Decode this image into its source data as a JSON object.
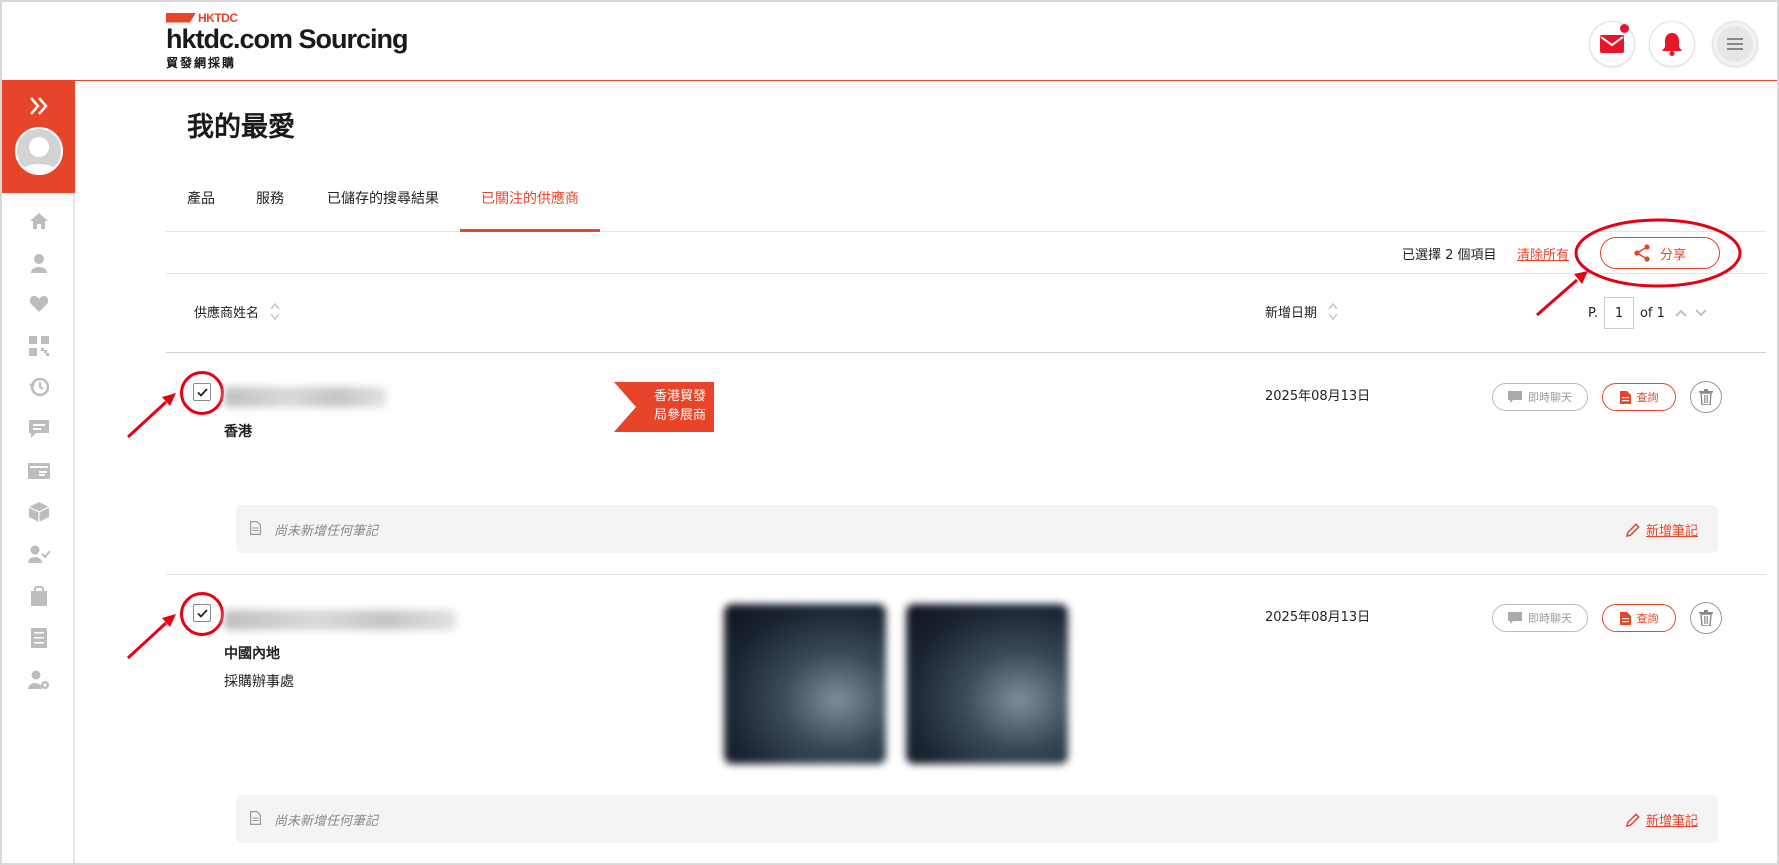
{
  "header": {
    "logo_brand": "HKTDC",
    "logo_title": "hktdc.com Sourcing",
    "logo_subtitle": "貿發網採購",
    "mail_icon": "mail-icon",
    "bell_icon": "bell-icon",
    "menu_icon": "menu-icon",
    "brand_color": "#e8442a"
  },
  "sidebar": {
    "expand_icon": "double-chevron-right-icon",
    "items": [
      "home-icon",
      "user-icon",
      "heart-icon",
      "qr-code-icon",
      "history-icon",
      "chat-icon",
      "id-card-icon",
      "box-icon",
      "user-check-icon",
      "bag-icon",
      "list-icon",
      "user-settings-icon"
    ]
  },
  "page": {
    "title": "我的最愛",
    "tabs": [
      {
        "label": "產品",
        "active": false
      },
      {
        "label": "服務",
        "active": false
      },
      {
        "label": "已儲存的搜尋結果",
        "active": false
      },
      {
        "label": "已關注的供應商",
        "active": true
      }
    ]
  },
  "selection": {
    "count_text": "已選擇 2 個項目",
    "clear_label": "清除所有",
    "share_label": "分享"
  },
  "columns": {
    "supplier_name": "供應商姓名",
    "date_added": "新增日期",
    "page_prefix": "P.",
    "page_value": "1",
    "page_of": "of 1"
  },
  "rows": [
    {
      "region": "香港",
      "sub_type": "",
      "badge_line1": "香港貿發",
      "badge_line2": "局參展商",
      "date": "2025年08月13日",
      "chat_label": "即時聊天",
      "enquiry_label": "查詢",
      "note_placeholder": "尚未新增任何筆記",
      "add_note_label": "新增筆記",
      "checked": true
    },
    {
      "region": "中國內地",
      "sub_type": "採購辦事處",
      "date": "2025年08月13日",
      "chat_label": "即時聊天",
      "enquiry_label": "查詢",
      "note_placeholder": "尚未新增任何筆記",
      "add_note_label": "新增筆記",
      "checked": true
    }
  ]
}
